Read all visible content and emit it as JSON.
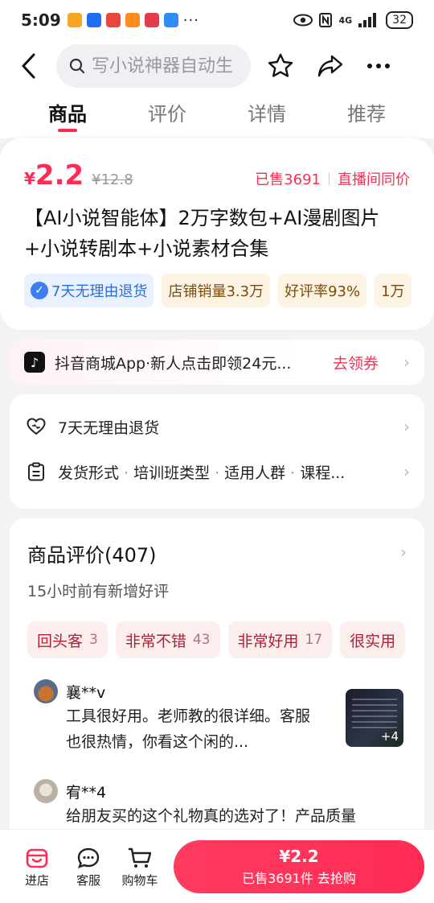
{
  "status_bar": {
    "time": "5:09",
    "dots": "···",
    "network": "4G",
    "battery": "32"
  },
  "header": {
    "search_placeholder": "写小说神器自动生"
  },
  "tabs": [
    {
      "label": "商品",
      "active": true
    },
    {
      "label": "评价",
      "active": false
    },
    {
      "label": "详情",
      "active": false
    },
    {
      "label": "推荐",
      "active": false
    }
  ],
  "product": {
    "currency": "¥",
    "price": "2.2",
    "old_price": "¥12.8",
    "sold": "已售3691",
    "live_same": "直播间同价",
    "title": "【AI小说智能体】2万字数包+AI漫剧图片+小说转剧本+小说素材合集",
    "tags": [
      {
        "label": "7天无理由退货",
        "style": "blue"
      },
      {
        "label": "店铺销量3.3万",
        "style": "gold"
      },
      {
        "label": "好评率93%",
        "style": "gold"
      },
      {
        "label": "1万",
        "style": "gold"
      }
    ]
  },
  "promo": {
    "logo": "♪",
    "text": "抖音商城App·新人点击即领24元...",
    "cta": "去领券"
  },
  "service": {
    "return_policy": "7天无理由退货",
    "attrs": [
      "发货形式",
      "培训班类型",
      "适用人群",
      "课程..."
    ]
  },
  "reviews": {
    "title": "商品评价(407)",
    "subtitle": "15小时前有新增好评",
    "tags": [
      {
        "label": "回头客",
        "count": "3"
      },
      {
        "label": "非常不错",
        "count": "43"
      },
      {
        "label": "非常好用",
        "count": "17"
      },
      {
        "label": "很实用",
        "count": ""
      }
    ],
    "items": [
      {
        "user": "襄**v",
        "text": "工具很好用。老师教的很详细。客服也很热情，你看这个闲的...",
        "extra_images": "+4"
      },
      {
        "user": "宥**4",
        "text": "给朋友买的这个礼物真的选对了！产品质量",
        "extra_images": ""
      }
    ]
  },
  "bottom_bar": {
    "store": "进店",
    "service": "客服",
    "cart": "购物车",
    "buy_price": "¥2.2",
    "buy_sub": "已售3691件  去抢购"
  },
  "colors": {
    "accent": "#fe2c55",
    "tag_blue": "#2b6fd6",
    "tag_gold_bg": "#fdf3e3"
  }
}
